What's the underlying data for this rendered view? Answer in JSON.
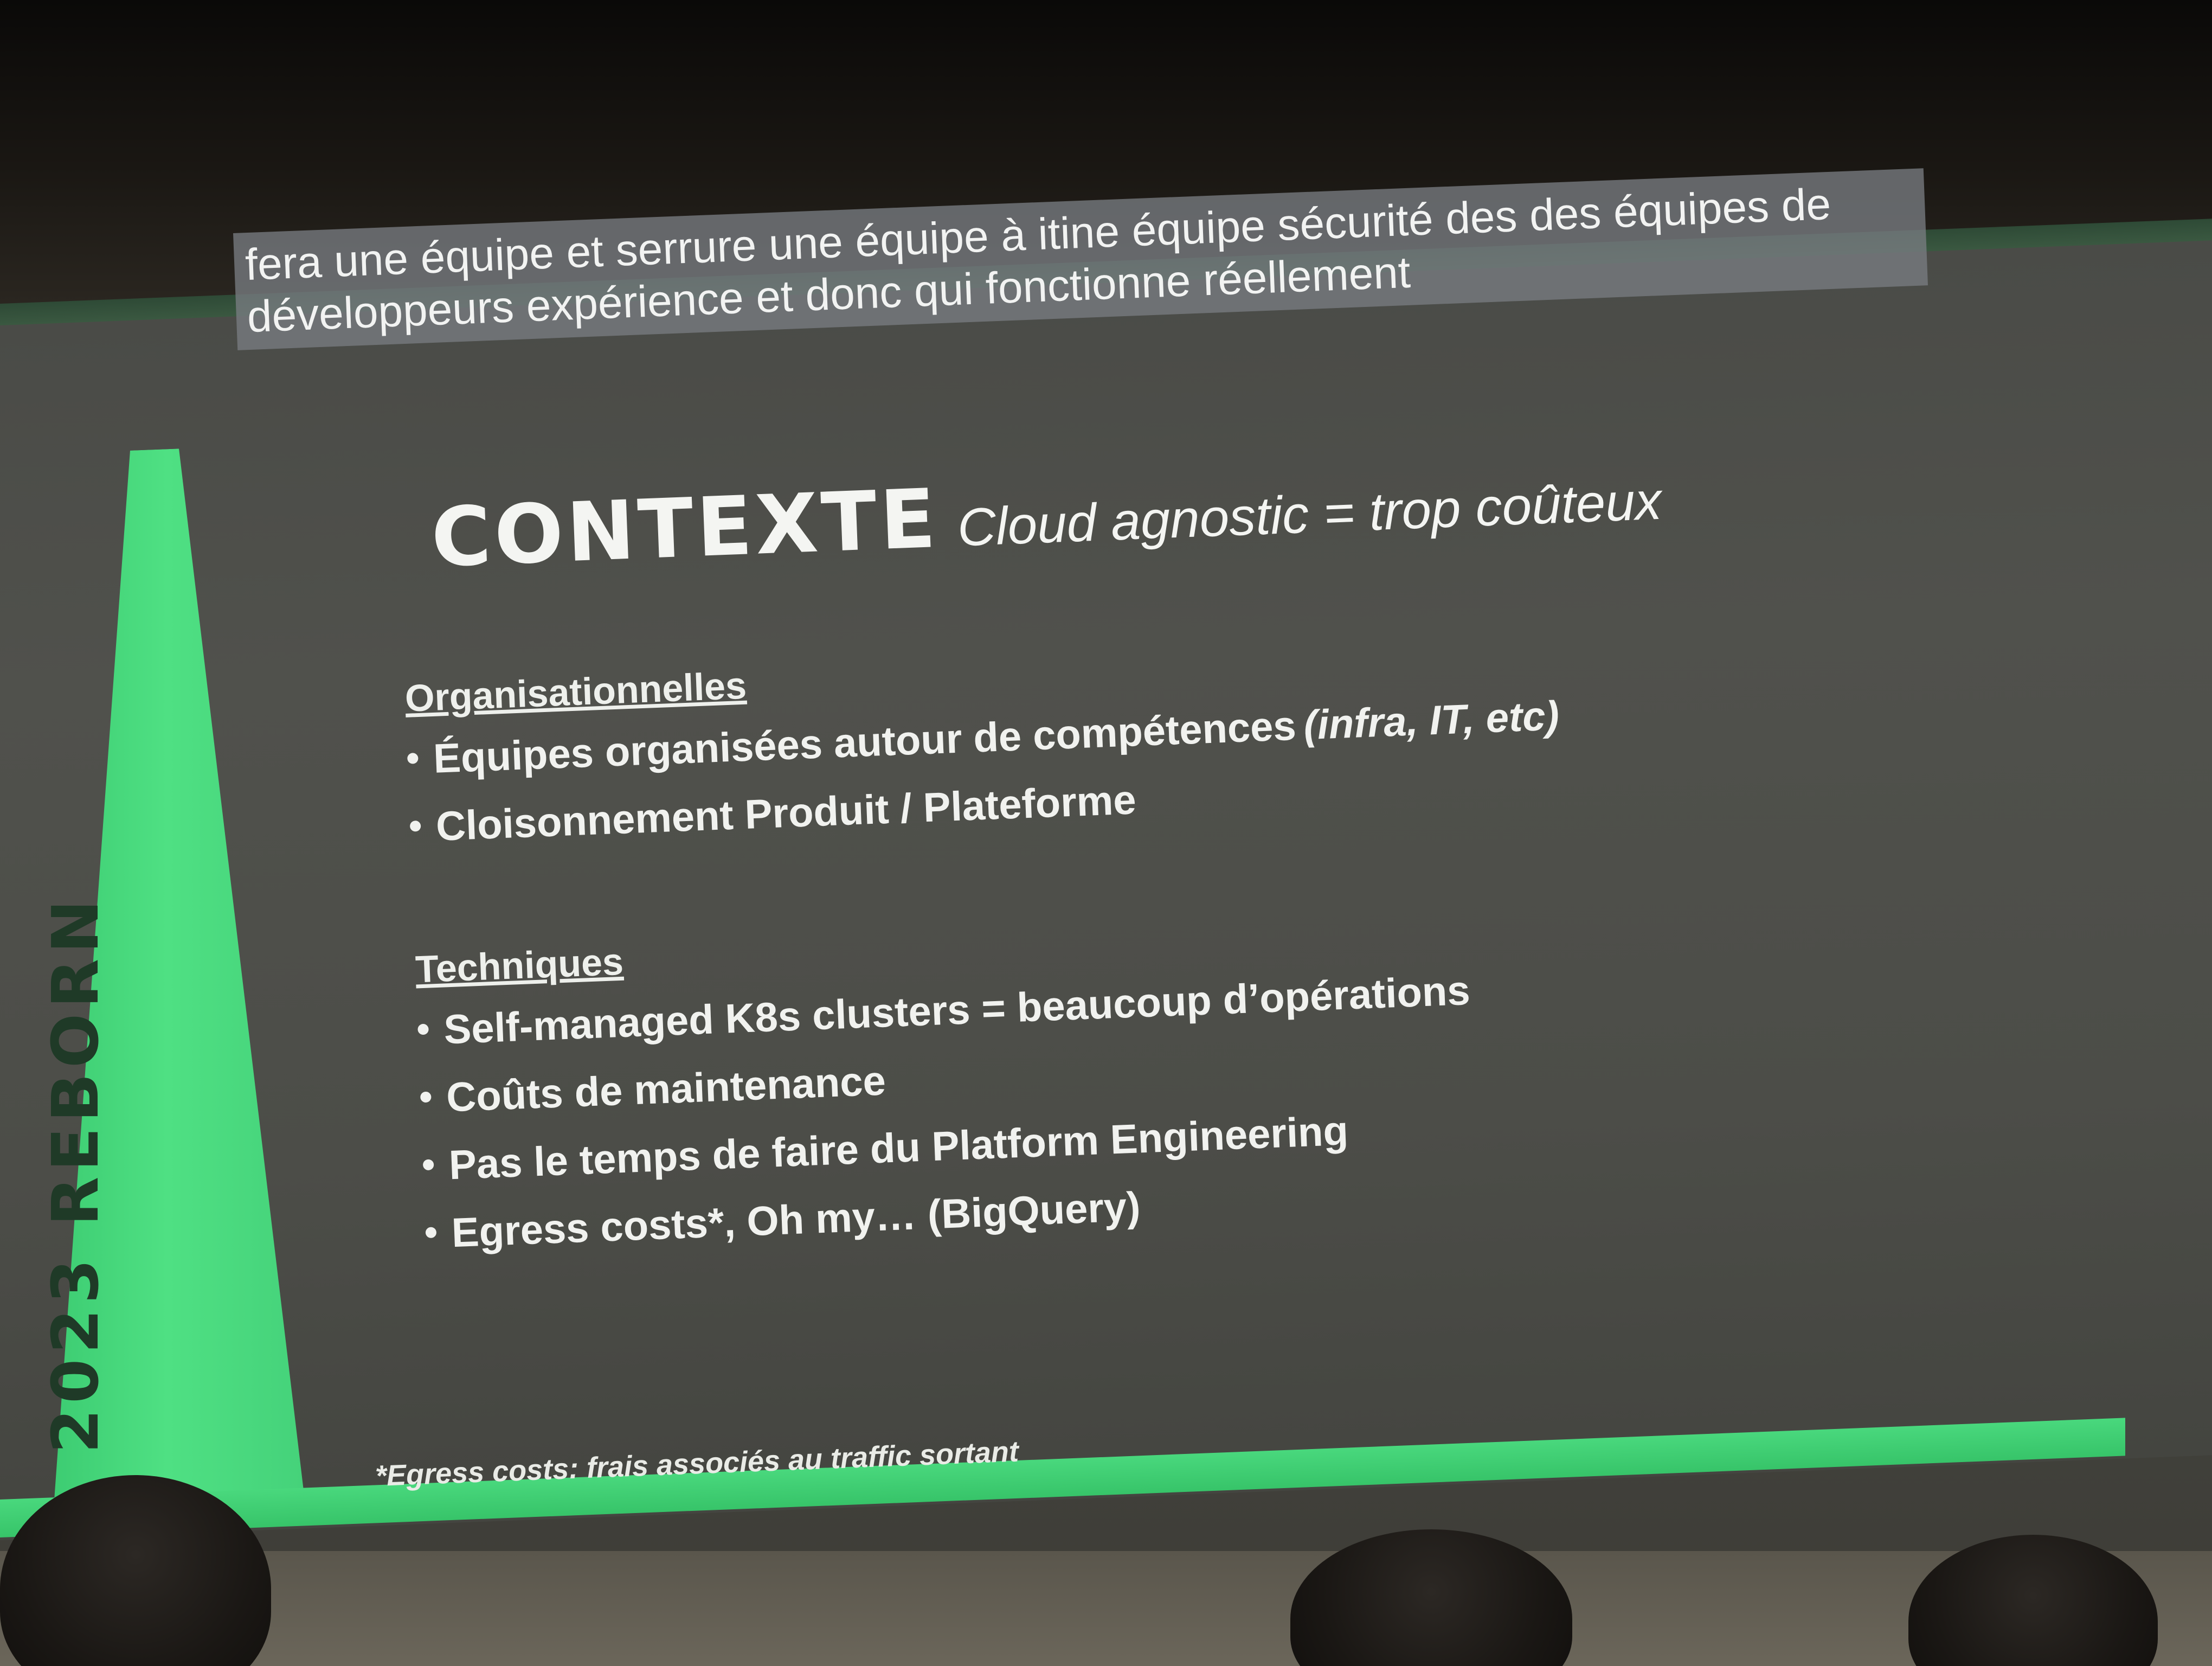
{
  "subtitles": {
    "line1": "fera une équipe et serrure une équipe à itine équipe sécurité des des équipes de",
    "line2": "développeurs expérience et donc qui fonctionne réellement"
  },
  "slide": {
    "title_main": "CONTEXTE",
    "title_sub": "Cloud agnostic = trop coûteux",
    "side_label": "2023 REBORN",
    "sections": [
      {
        "heading": "Organisationnelles",
        "bullets": [
          {
            "text": "Équipes organisées autour de compétences",
            "emph": "(infra, IT, etc)"
          },
          {
            "text": "Cloisonnement Produit / Plateforme",
            "emph": ""
          }
        ]
      },
      {
        "heading": "Techniques",
        "bullets": [
          {
            "text": "Self-managed K8s clusters = beaucoup d’opérations",
            "emph": ""
          },
          {
            "text": "Coûts de maintenance",
            "emph": ""
          },
          {
            "text": "Pas le temps de faire du Platform Engineering",
            "emph": ""
          },
          {
            "text": "Egress costs*, Oh my… (BigQuery)",
            "emph": ""
          }
        ]
      }
    ],
    "footnote": "*Egress costs: frais associés au traffic sortant"
  },
  "colors": {
    "accent_green": "#4fe083",
    "slide_bg": "#4c4d48",
    "text": "#f1f2ef"
  }
}
